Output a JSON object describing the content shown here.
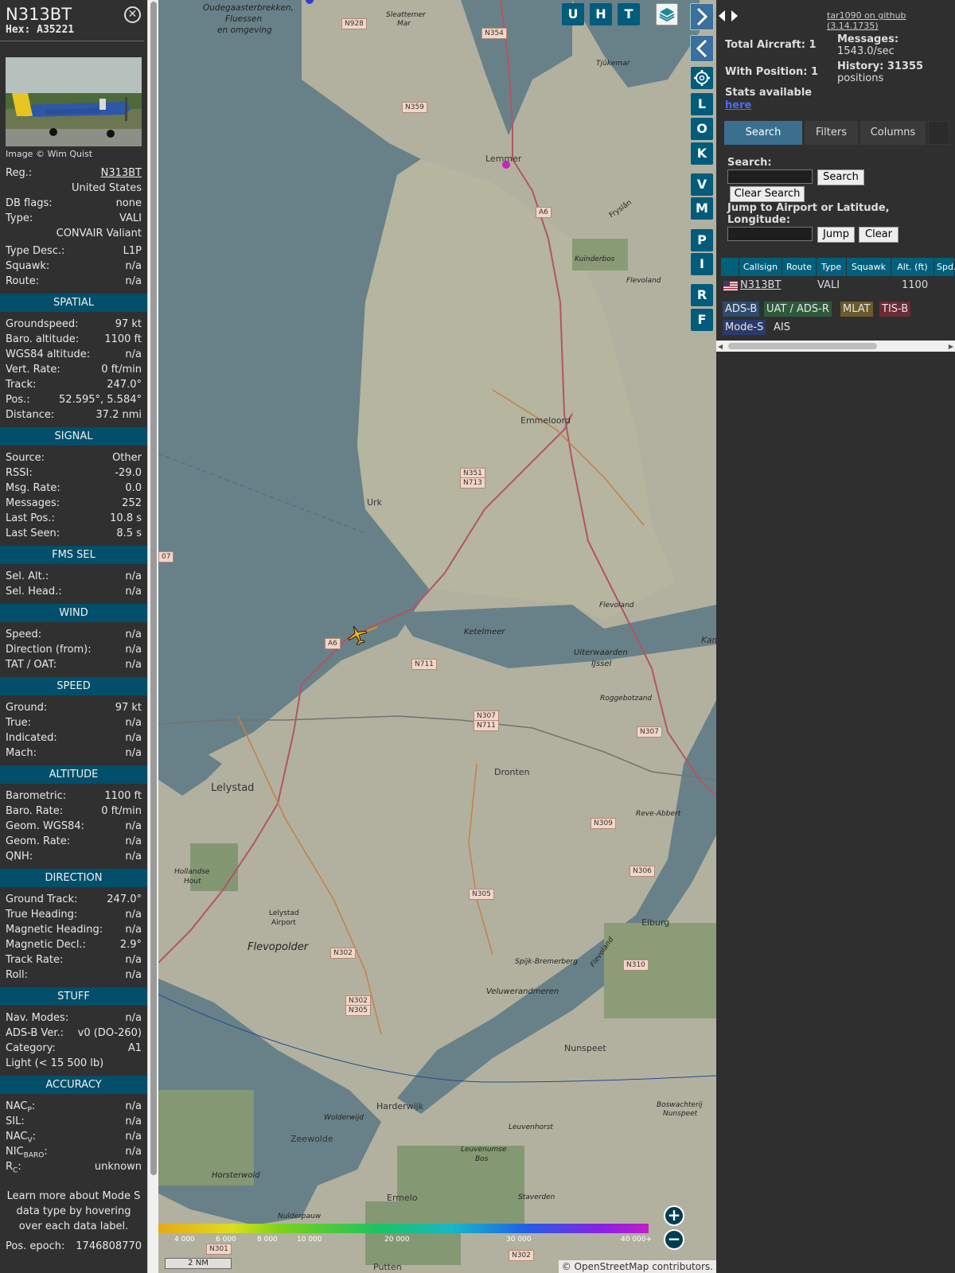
{
  "aircraft": {
    "callsign": "N313BT",
    "hex_label": "Hex:",
    "hex": "A35221",
    "image_credit": "Image © Wim Quist",
    "reg_label": "Reg.:",
    "reg": "N313BT",
    "country": "United States",
    "dbflags_label": "DB flags:",
    "dbflags": "none",
    "type_label": "Type:",
    "type": "VALI",
    "type_full": "CONVAIR Valiant",
    "typedesc_label": "Type Desc.:",
    "typedesc": "L1P",
    "squawk_label": "Squawk:",
    "squawk": "n/a",
    "route_label": "Route:",
    "route": "n/a"
  },
  "sections": {
    "spatial": {
      "title": "SPATIAL",
      "rows": [
        {
          "label": "Groundspeed:",
          "value": "97 kt"
        },
        {
          "label": "Baro. altitude:",
          "value": "1100 ft"
        },
        {
          "label": "WGS84 altitude:",
          "value": "n/a"
        },
        {
          "label": "Vert. Rate:",
          "value": "0 ft/min"
        },
        {
          "label": "Track:",
          "value": "247.0°"
        },
        {
          "label": "Pos.:",
          "value": "52.595°, 5.584°"
        },
        {
          "label": "Distance:",
          "value": "37.2 nmi"
        }
      ]
    },
    "signal": {
      "title": "SIGNAL",
      "rows": [
        {
          "label": "Source:",
          "value": "Other"
        },
        {
          "label": "RSSI:",
          "value": "-29.0"
        },
        {
          "label": "Msg. Rate:",
          "value": "0.0"
        },
        {
          "label": "Messages:",
          "value": "252"
        },
        {
          "label": "Last Pos.:",
          "value": "10.8 s"
        },
        {
          "label": "Last Seen:",
          "value": "8.5 s"
        }
      ]
    },
    "fms": {
      "title": "FMS SEL",
      "rows": [
        {
          "label": "Sel. Alt.:",
          "value": "n/a"
        },
        {
          "label": "Sel. Head.:",
          "value": "n/a"
        }
      ]
    },
    "wind": {
      "title": "WIND",
      "rows": [
        {
          "label": "Speed:",
          "value": "n/a"
        },
        {
          "label": "Direction (from):",
          "value": "n/a"
        },
        {
          "label": "TAT / OAT:",
          "value": "n/a"
        }
      ]
    },
    "speed": {
      "title": "SPEED",
      "rows": [
        {
          "label": "Ground:",
          "value": "97 kt"
        },
        {
          "label": "True:",
          "value": "n/a"
        },
        {
          "label": "Indicated:",
          "value": "n/a"
        },
        {
          "label": "Mach:",
          "value": "n/a"
        }
      ]
    },
    "altitude": {
      "title": "ALTITUDE",
      "rows": [
        {
          "label": "Barometric:",
          "value": "1100 ft"
        },
        {
          "label": "Baro. Rate:",
          "value": "0 ft/min"
        },
        {
          "label": "Geom. WGS84:",
          "value": "n/a"
        },
        {
          "label": "Geom. Rate:",
          "value": "n/a"
        },
        {
          "label": "QNH:",
          "value": "n/a"
        }
      ]
    },
    "direction": {
      "title": "DIRECTION",
      "rows": [
        {
          "label": "Ground Track:",
          "value": "247.0°"
        },
        {
          "label": "True Heading:",
          "value": "n/a"
        },
        {
          "label": "Magnetic Heading:",
          "value": "n/a"
        },
        {
          "label": "Magnetic Decl.:",
          "value": "2.9°"
        },
        {
          "label": "Track Rate:",
          "value": "n/a"
        },
        {
          "label": "Roll:",
          "value": "n/a"
        }
      ]
    },
    "stuff": {
      "title": "STUFF",
      "rows": [
        {
          "label": "Nav. Modes:",
          "value": "n/a"
        },
        {
          "label": "ADS-B Ver.:",
          "value": "v0 (DO-260)"
        },
        {
          "label": "Category:",
          "value": "A1"
        }
      ],
      "category_desc": "Light (< 15 500 lb)"
    },
    "accuracy": {
      "title": "ACCURACY",
      "rows": [
        {
          "label": "NAC",
          "sub": "P",
          "value": "n/a"
        },
        {
          "label": "SIL:",
          "sub": "",
          "value": "n/a"
        },
        {
          "label": "NAC",
          "sub": "V",
          "value": "n/a"
        },
        {
          "label": "NIC",
          "sub": "BARO",
          "value": "n/a"
        },
        {
          "label": "R",
          "sub": "C",
          "value": "unknown"
        }
      ]
    },
    "note": "Learn more about Mode S data type by hovering over each data label.",
    "pos_epoch_label": "Pos. epoch:",
    "pos_epoch": "1746808770"
  },
  "map": {
    "buttons_top": [
      "U",
      "H",
      "T"
    ],
    "side_buttons": [
      "L",
      "O",
      "K",
      "V",
      "M",
      "P",
      "I",
      "R",
      "F"
    ],
    "places": {
      "oudega": "Oudegaasterbrekken,",
      "fluessen": "Fluessen",
      "omgeving": "en omgeving",
      "slotermeer": "Sleattemer",
      "mar": "Mar",
      "tjukemar": "Tjûkemar",
      "lemmer": "Lemmer",
      "fryslan": "Fryslân",
      "kuinderbos": "Kuinderbos",
      "flevoland_ne": "Flevoland",
      "emmeloord": "Emmeloord",
      "urk": "Urk",
      "flevoland_mid": "Flevoland",
      "ketelmeer": "Ketelmeer",
      "uiterwaarden": "Uiterwaarden",
      "ijssel": "IJssel",
      "kampen": "Kampere",
      "roggebot": "Roggebotzand",
      "dronten": "Dronten",
      "lelystad": "Lelystad",
      "reve": "Reve-Abbert",
      "hollandse": "Hollandse",
      "hout": "Hout",
      "lelystad_ap": "Lelystad",
      "airport": "Airport",
      "flevopolder": "Flevopolder",
      "elburg": "Elburg",
      "spijk": "Spijk-Bremerberg",
      "flevoland_se": "Flevoland",
      "veluwe": "Veluwerandmeren",
      "nunspeet": "Nunspeet",
      "bos": "Boswachterij",
      "bos2": "Nunspeet",
      "harderwijk": "Harderwijk",
      "zeewolde": "Zeewolde",
      "wolderwijd": "Wolderwijd",
      "leuvenumse": "Leuvenumse",
      "bos3": "Bos",
      "leuvenhorst": "Leuvenhorst",
      "horsterwold": "Horsterwold",
      "ermelo": "Ermelo",
      "staverden": "Staverden",
      "nulde": "Nulderpauw",
      "putten": "Putten"
    },
    "roads": [
      "N928",
      "N354",
      "N359",
      "A6",
      "N351",
      "N713",
      "A6",
      "N711",
      "N307",
      "N711",
      "N307",
      "N309",
      "N306",
      "N305",
      "N302",
      "N302",
      "N305",
      "N310",
      "N302",
      "N301",
      "07"
    ],
    "altitude_scale": [
      "4 000",
      "6 000",
      "8 000",
      "10 000",
      "20 000",
      "30 000",
      "40 000+"
    ],
    "scale_bar": "2 NM",
    "attribution": "© OpenStreetMap contributors."
  },
  "panel": {
    "github_link": "tar1090 on github (3.14.1735)",
    "total_aircraft": "Total Aircraft: 1",
    "with_position": "With Position: 1",
    "messages_label": "Messages:",
    "messages_rate": "1543.0/sec",
    "history_label": "History: 31355",
    "history_unit": "positions",
    "stats": "Stats available",
    "stats_link": "here",
    "tabs": [
      "Search",
      "Filters",
      "Columns"
    ],
    "search_label": "Search:",
    "search_placeholder": "",
    "search_btn": "Search",
    "clear_search_btn": "Clear Search",
    "jump_label": "Jump to Airport or Latitude, Longitude:",
    "jump_btn": "Jump",
    "clear_btn": "Clear",
    "table_headers": [
      "Callsign",
      "Route",
      "Type",
      "Squawk",
      "Alt. (ft)",
      "Spd."
    ],
    "table_rows": [
      [
        "N313BT",
        "",
        "VALI",
        "",
        "1100",
        ""
      ]
    ],
    "badges": [
      "ADS-B",
      "UAT / ADS-R",
      "MLAT",
      "TIS-B",
      "Mode-S",
      "AIS"
    ],
    "colors": {
      "adsb": "#2e4a6b",
      "uat": "#2f5a3a",
      "mlat": "#6b5a2a",
      "tisb": "#6b2a35",
      "modes": "#2a3a6b"
    }
  }
}
